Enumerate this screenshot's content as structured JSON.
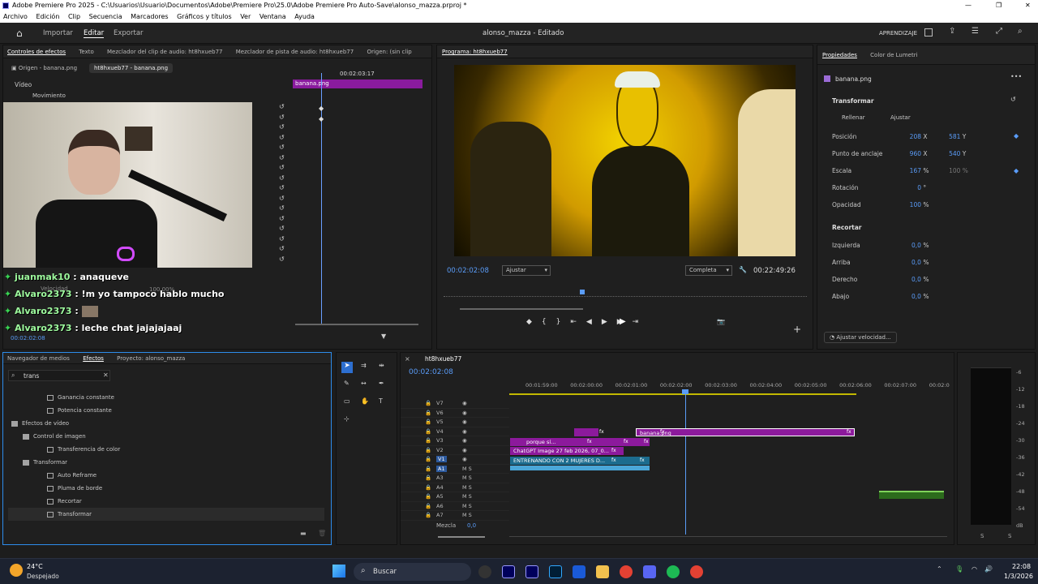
{
  "window": {
    "title": "Adobe Premiere Pro 2025 - C:\\Usuarios\\Usuario\\Documentos\\Adobe\\Premiere Pro\\25.0\\Adobe Premiere Pro Auto-Save\\alonso_mazza.prproj *"
  },
  "menu": [
    "Archivo",
    "Edición",
    "Clip",
    "Secuencia",
    "Marcadores",
    "Gráficos y títulos",
    "Ver",
    "Ventana",
    "Ayuda"
  ],
  "header": {
    "tabs": [
      "Importar",
      "Editar",
      "Exportar"
    ],
    "project_title": "alonso_mazza - Editado",
    "learn": "APRENDIZAJE"
  },
  "effect_controls": {
    "tabs": [
      "Controles de efectos",
      "Texto",
      "Mezclador del clip de audio: ht8hxueb77",
      "Mezclador de pista de audio: ht8hxueb77",
      "Origen: (sin clip"
    ],
    "source_tab": "Origen - banana.png",
    "seq_tab": "ht8hxueb77 - banana.png",
    "timecode": "00:02:03:17",
    "clip_label": "banana.png",
    "video_label": "Vídeo",
    "motion_label": "Movimiento",
    "velocidad_label": "Velocidad",
    "velocidad_value": "100,00%",
    "footer_time": "00:02:02:08"
  },
  "chat": [
    {
      "user": "juanmak10",
      "text": ": anaqueve"
    },
    {
      "user": "Alvaro2373",
      "text": ": !m yo tampoco hablo mucho"
    },
    {
      "user": "Alvaro2373",
      "text": ":"
    },
    {
      "user": "Alvaro2373",
      "text": ": leche chat jajajajaaj"
    }
  ],
  "program": {
    "title": "Programa: ht8hxueb77",
    "timecode": "00:02:02:08",
    "fit": "Ajustar",
    "quality": "Completa",
    "duration": "00:22:49:26"
  },
  "properties": {
    "tabs": [
      "Propiedades",
      "Color de Lumetri"
    ],
    "clip": "banana.png",
    "section_transform": "Transformar",
    "fill": "Rellenar",
    "fit": "Ajustar",
    "rows": [
      {
        "label": "Posición",
        "v1": "208",
        "u1": "X",
        "v2": "581",
        "u2": "Y"
      },
      {
        "label": "Punto de anclaje",
        "v1": "960",
        "u1": "X",
        "v2": "540",
        "u2": "Y"
      },
      {
        "label": "Escala",
        "v1": "167",
        "u1": "%",
        "v2": "100",
        "u2": "%"
      },
      {
        "label": "Rotación",
        "v1": "0",
        "u1": "°",
        "v2": "",
        "u2": ""
      },
      {
        "label": "Opacidad",
        "v1": "100",
        "u1": "%",
        "v2": "",
        "u2": ""
      }
    ],
    "section_crop": "Recortar",
    "crop_rows": [
      {
        "label": "Izquierda",
        "v1": "0,0",
        "u1": "%"
      },
      {
        "label": "Arriba",
        "v1": "0,0",
        "u1": "%"
      },
      {
        "label": "Derecho",
        "v1": "0,0",
        "u1": "%"
      },
      {
        "label": "Abajo",
        "v1": "0,0",
        "u1": "%"
      }
    ],
    "speed_button": "Ajustar velocidad..."
  },
  "effects": {
    "tabs": [
      "Navegador de medios",
      "Efectos",
      "Proyecto: alonso_mazza"
    ],
    "search": "trans",
    "items": [
      {
        "label": "Ganancia constante",
        "indent": 2,
        "type": "fx"
      },
      {
        "label": "Potencia constante",
        "indent": 2,
        "type": "fx"
      },
      {
        "label": "Efectos de vídeo",
        "indent": 0,
        "type": "folder"
      },
      {
        "label": "Control de imagen",
        "indent": 1,
        "type": "folder"
      },
      {
        "label": "Transferencia de color",
        "indent": 2,
        "type": "fx"
      },
      {
        "label": "Transformar",
        "indent": 1,
        "type": "folder"
      },
      {
        "label": "Auto Reframe",
        "indent": 2,
        "type": "fx"
      },
      {
        "label": "Pluma de borde",
        "indent": 2,
        "type": "fx"
      },
      {
        "label": "Recortar",
        "indent": 2,
        "type": "fx"
      },
      {
        "label": "Transformar",
        "indent": 2,
        "type": "fx"
      }
    ]
  },
  "timeline": {
    "title": "ht8hxueb77",
    "timecode": "00:02:02:08",
    "ruler": [
      "00:01:59:00",
      "00:02:00:00",
      "00:02:01:00",
      "00:02:02:00",
      "00:02:03:00",
      "00:02:04:00",
      "00:02:05:00",
      "00:02:06:00",
      "00:02:07:00",
      "00:02:0"
    ],
    "video_tracks": [
      "V7",
      "V6",
      "V5",
      "V4",
      "V3",
      "V2",
      "V1"
    ],
    "audio_tracks": [
      "A1",
      "A3",
      "A4",
      "A5",
      "A6",
      "A7"
    ],
    "mix_label": "Mezcla",
    "mix_value": "0,0",
    "clips": {
      "v4": "banana.png",
      "v3": "porque sí...",
      "v2": "ChatGPT Image 27 feb 2026, 07_0...",
      "v1": "ENTRENANDO CON 2 MUJERES D..."
    },
    "fx": "fx"
  },
  "meter": {
    "scale": [
      "-6",
      "-12",
      "-18",
      "-24",
      "-30",
      "-36",
      "-42",
      "-48",
      "-54",
      "dB"
    ],
    "s": "S"
  },
  "taskbar": {
    "temp": "24°C",
    "weather": "Despejado",
    "search": "Buscar",
    "time": "22:08",
    "date": "1/3/2026"
  }
}
